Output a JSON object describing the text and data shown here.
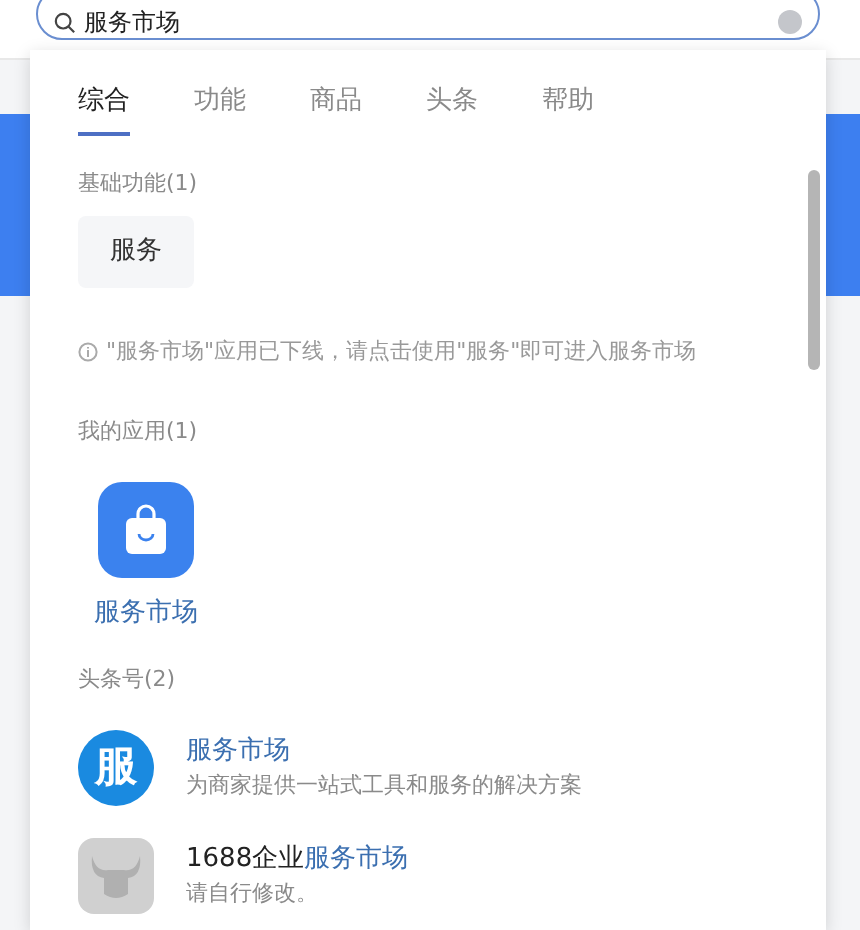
{
  "search": {
    "value": "服务市场"
  },
  "tabs": [
    {
      "label": "综合",
      "selected": true
    },
    {
      "label": "功能",
      "selected": false
    },
    {
      "label": "商品",
      "selected": false
    },
    {
      "label": "头条",
      "selected": false
    },
    {
      "label": "帮助",
      "selected": false
    }
  ],
  "basic_functions": {
    "heading": "基础功能(1)",
    "items": [
      "服务"
    ],
    "notice": "\"服务市场\"应用已下线，请点击使用\"服务\"即可进入服务市场"
  },
  "my_apps": {
    "heading": "我的应用(1)",
    "items": [
      {
        "label": "服务市场"
      }
    ]
  },
  "toutiao": {
    "heading": "头条号(2)",
    "items": [
      {
        "kind": "logo",
        "avatar_text": "服",
        "title_parts": [
          {
            "text": "服务市场",
            "highlight": true
          }
        ],
        "subtitle": "为商家提供一站式工具和服务的解决方案"
      },
      {
        "kind": "placeholder",
        "title_parts": [
          {
            "text": "1688企业",
            "highlight": false
          },
          {
            "text": "服务市场",
            "highlight": true
          }
        ],
        "subtitle": "请自行修改。"
      }
    ]
  }
}
